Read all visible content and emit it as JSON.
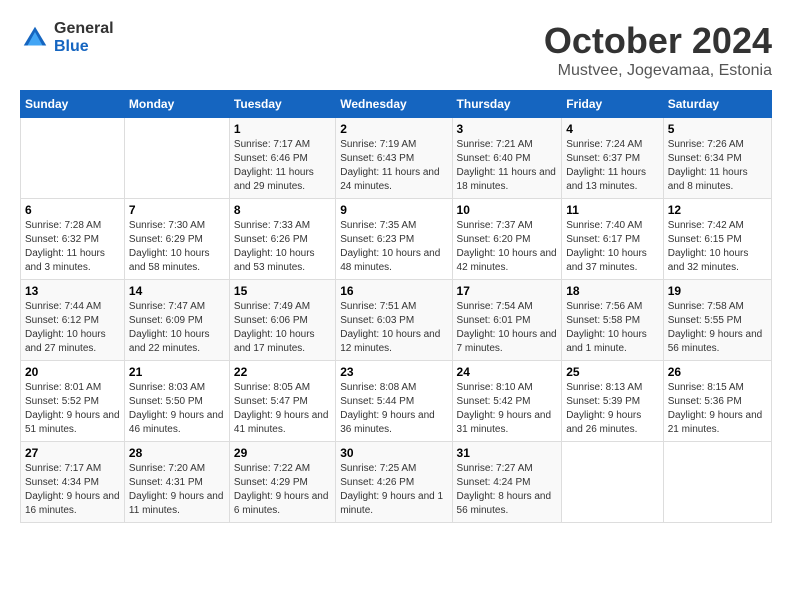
{
  "logo": {
    "general": "General",
    "blue": "Blue"
  },
  "title": "October 2024",
  "subtitle": "Mustvee, Jogevamaa, Estonia",
  "days_of_week": [
    "Sunday",
    "Monday",
    "Tuesday",
    "Wednesday",
    "Thursday",
    "Friday",
    "Saturday"
  ],
  "weeks": [
    [
      {
        "day": "",
        "sunrise": "",
        "sunset": "",
        "daylight": ""
      },
      {
        "day": "",
        "sunrise": "",
        "sunset": "",
        "daylight": ""
      },
      {
        "day": "1",
        "sunrise": "Sunrise: 7:17 AM",
        "sunset": "Sunset: 6:46 PM",
        "daylight": "Daylight: 11 hours and 29 minutes."
      },
      {
        "day": "2",
        "sunrise": "Sunrise: 7:19 AM",
        "sunset": "Sunset: 6:43 PM",
        "daylight": "Daylight: 11 hours and 24 minutes."
      },
      {
        "day": "3",
        "sunrise": "Sunrise: 7:21 AM",
        "sunset": "Sunset: 6:40 PM",
        "daylight": "Daylight: 11 hours and 18 minutes."
      },
      {
        "day": "4",
        "sunrise": "Sunrise: 7:24 AM",
        "sunset": "Sunset: 6:37 PM",
        "daylight": "Daylight: 11 hours and 13 minutes."
      },
      {
        "day": "5",
        "sunrise": "Sunrise: 7:26 AM",
        "sunset": "Sunset: 6:34 PM",
        "daylight": "Daylight: 11 hours and 8 minutes."
      }
    ],
    [
      {
        "day": "6",
        "sunrise": "Sunrise: 7:28 AM",
        "sunset": "Sunset: 6:32 PM",
        "daylight": "Daylight: 11 hours and 3 minutes."
      },
      {
        "day": "7",
        "sunrise": "Sunrise: 7:30 AM",
        "sunset": "Sunset: 6:29 PM",
        "daylight": "Daylight: 10 hours and 58 minutes."
      },
      {
        "day": "8",
        "sunrise": "Sunrise: 7:33 AM",
        "sunset": "Sunset: 6:26 PM",
        "daylight": "Daylight: 10 hours and 53 minutes."
      },
      {
        "day": "9",
        "sunrise": "Sunrise: 7:35 AM",
        "sunset": "Sunset: 6:23 PM",
        "daylight": "Daylight: 10 hours and 48 minutes."
      },
      {
        "day": "10",
        "sunrise": "Sunrise: 7:37 AM",
        "sunset": "Sunset: 6:20 PM",
        "daylight": "Daylight: 10 hours and 42 minutes."
      },
      {
        "day": "11",
        "sunrise": "Sunrise: 7:40 AM",
        "sunset": "Sunset: 6:17 PM",
        "daylight": "Daylight: 10 hours and 37 minutes."
      },
      {
        "day": "12",
        "sunrise": "Sunrise: 7:42 AM",
        "sunset": "Sunset: 6:15 PM",
        "daylight": "Daylight: 10 hours and 32 minutes."
      }
    ],
    [
      {
        "day": "13",
        "sunrise": "Sunrise: 7:44 AM",
        "sunset": "Sunset: 6:12 PM",
        "daylight": "Daylight: 10 hours and 27 minutes."
      },
      {
        "day": "14",
        "sunrise": "Sunrise: 7:47 AM",
        "sunset": "Sunset: 6:09 PM",
        "daylight": "Daylight: 10 hours and 22 minutes."
      },
      {
        "day": "15",
        "sunrise": "Sunrise: 7:49 AM",
        "sunset": "Sunset: 6:06 PM",
        "daylight": "Daylight: 10 hours and 17 minutes."
      },
      {
        "day": "16",
        "sunrise": "Sunrise: 7:51 AM",
        "sunset": "Sunset: 6:03 PM",
        "daylight": "Daylight: 10 hours and 12 minutes."
      },
      {
        "day": "17",
        "sunrise": "Sunrise: 7:54 AM",
        "sunset": "Sunset: 6:01 PM",
        "daylight": "Daylight: 10 hours and 7 minutes."
      },
      {
        "day": "18",
        "sunrise": "Sunrise: 7:56 AM",
        "sunset": "Sunset: 5:58 PM",
        "daylight": "Daylight: 10 hours and 1 minute."
      },
      {
        "day": "19",
        "sunrise": "Sunrise: 7:58 AM",
        "sunset": "Sunset: 5:55 PM",
        "daylight": "Daylight: 9 hours and 56 minutes."
      }
    ],
    [
      {
        "day": "20",
        "sunrise": "Sunrise: 8:01 AM",
        "sunset": "Sunset: 5:52 PM",
        "daylight": "Daylight: 9 hours and 51 minutes."
      },
      {
        "day": "21",
        "sunrise": "Sunrise: 8:03 AM",
        "sunset": "Sunset: 5:50 PM",
        "daylight": "Daylight: 9 hours and 46 minutes."
      },
      {
        "day": "22",
        "sunrise": "Sunrise: 8:05 AM",
        "sunset": "Sunset: 5:47 PM",
        "daylight": "Daylight: 9 hours and 41 minutes."
      },
      {
        "day": "23",
        "sunrise": "Sunrise: 8:08 AM",
        "sunset": "Sunset: 5:44 PM",
        "daylight": "Daylight: 9 hours and 36 minutes."
      },
      {
        "day": "24",
        "sunrise": "Sunrise: 8:10 AM",
        "sunset": "Sunset: 5:42 PM",
        "daylight": "Daylight: 9 hours and 31 minutes."
      },
      {
        "day": "25",
        "sunrise": "Sunrise: 8:13 AM",
        "sunset": "Sunset: 5:39 PM",
        "daylight": "Daylight: 9 hours and 26 minutes."
      },
      {
        "day": "26",
        "sunrise": "Sunrise: 8:15 AM",
        "sunset": "Sunset: 5:36 PM",
        "daylight": "Daylight: 9 hours and 21 minutes."
      }
    ],
    [
      {
        "day": "27",
        "sunrise": "Sunrise: 7:17 AM",
        "sunset": "Sunset: 4:34 PM",
        "daylight": "Daylight: 9 hours and 16 minutes."
      },
      {
        "day": "28",
        "sunrise": "Sunrise: 7:20 AM",
        "sunset": "Sunset: 4:31 PM",
        "daylight": "Daylight: 9 hours and 11 minutes."
      },
      {
        "day": "29",
        "sunrise": "Sunrise: 7:22 AM",
        "sunset": "Sunset: 4:29 PM",
        "daylight": "Daylight: 9 hours and 6 minutes."
      },
      {
        "day": "30",
        "sunrise": "Sunrise: 7:25 AM",
        "sunset": "Sunset: 4:26 PM",
        "daylight": "Daylight: 9 hours and 1 minute."
      },
      {
        "day": "31",
        "sunrise": "Sunrise: 7:27 AM",
        "sunset": "Sunset: 4:24 PM",
        "daylight": "Daylight: 8 hours and 56 minutes."
      },
      {
        "day": "",
        "sunrise": "",
        "sunset": "",
        "daylight": ""
      },
      {
        "day": "",
        "sunrise": "",
        "sunset": "",
        "daylight": ""
      }
    ]
  ]
}
